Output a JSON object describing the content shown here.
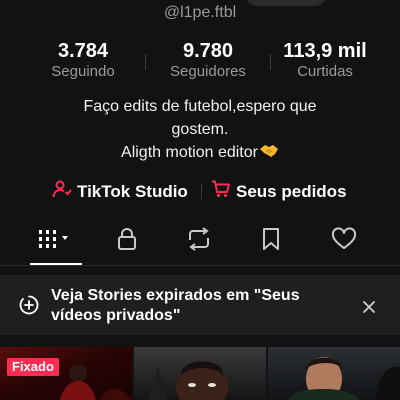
{
  "profile": {
    "username": "@l1pe.ftbl",
    "stats": [
      {
        "value": "3.784",
        "label": "Seguindo"
      },
      {
        "value": "9.780",
        "label": "Seguidores"
      },
      {
        "value": "113,9 mil",
        "label": "Curtidas"
      }
    ],
    "bio_lines": [
      "Faço edits de futebol,espero que",
      "gostem.",
      "Aligth motion editor"
    ],
    "bio_emoji": "handshake-icon"
  },
  "links": {
    "studio_label": "TikTok Studio",
    "orders_label": "Seus pedidos",
    "accent_color": "#fe2c55"
  },
  "tabs": [
    {
      "icon": "videos-grid-icon",
      "selected": true
    },
    {
      "icon": "lock-icon",
      "selected": false
    },
    {
      "icon": "repost-icon",
      "selected": false
    },
    {
      "icon": "bookmark-icon",
      "selected": false
    },
    {
      "icon": "heart-icon",
      "selected": false
    }
  ],
  "banner": {
    "text": "Veja Stories expirados em \"Seus vídeos privados\"",
    "icon": "story-add-icon",
    "close_icon": "close-icon"
  },
  "videos": [
    {
      "badge": "Fixado"
    },
    {
      "badge": ""
    },
    {
      "badge": ""
    }
  ]
}
